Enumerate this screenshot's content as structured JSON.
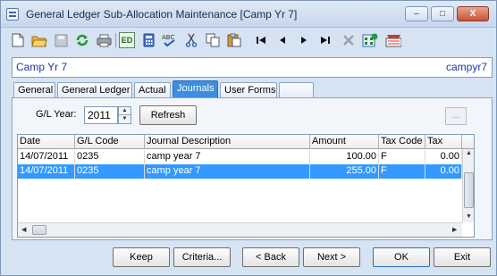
{
  "window": {
    "title": "General Ledger Sub-Allocation Maintenance  [Camp Yr 7]",
    "minimize": "–",
    "maximize": "□",
    "close": "X"
  },
  "toolbar": [
    {
      "name": "new-document-icon",
      "glyph": "🗋"
    },
    {
      "name": "open-folder-icon"
    },
    {
      "name": "save-icon"
    },
    {
      "name": "refresh-icon"
    },
    {
      "name": "print-icon"
    },
    {
      "name": "edit-mode-icon",
      "text": "ED"
    },
    {
      "name": "calculator-icon"
    },
    {
      "name": "spellcheck-icon",
      "text": "ABC"
    },
    {
      "name": "cut-icon"
    },
    {
      "name": "copy-icon"
    },
    {
      "name": "paste-icon"
    },
    {
      "name": "first-record-icon"
    },
    {
      "name": "previous-record-icon"
    },
    {
      "name": "next-record-icon"
    },
    {
      "name": "last-record-icon"
    },
    {
      "name": "delete-icon"
    },
    {
      "name": "add-record-icon"
    },
    {
      "name": "report-icon"
    }
  ],
  "entity": {
    "name": "Camp Yr 7",
    "code": "campyr7"
  },
  "tabs": [
    {
      "label": "General"
    },
    {
      "label": "General Ledger"
    },
    {
      "label": "Actual"
    },
    {
      "label": "Journals",
      "active": true
    },
    {
      "label": "User Forms"
    },
    {
      "label": ""
    }
  ],
  "filter": {
    "year_label": "G/L Year:",
    "year_value": "2011",
    "refresh_label": "Refresh",
    "ellipsis_label": "..."
  },
  "grid": {
    "columns": [
      "Date",
      "G/L Code",
      "Journal Description",
      "Amount",
      "Tax Code",
      "Tax"
    ],
    "rows": [
      {
        "date": "14/07/2011",
        "code": "0235",
        "description": "camp year 7",
        "amount": "100.00",
        "tax_code": "F",
        "tax": "0.00",
        "selected": false
      },
      {
        "date": "14/07/2011",
        "code": "0235",
        "description": "camp year 7",
        "amount": "255.00",
        "tax_code": "F",
        "tax": "0.00",
        "selected": true
      }
    ]
  },
  "buttons": {
    "keep": "Keep",
    "criteria": "Criteria...",
    "back": "< Back",
    "next": "Next >",
    "ok": "OK",
    "exit": "Exit"
  },
  "colors": {
    "selection": "#3399ff",
    "active_tab": "#3d8ee0",
    "entity_text": "#1c3aa0"
  }
}
